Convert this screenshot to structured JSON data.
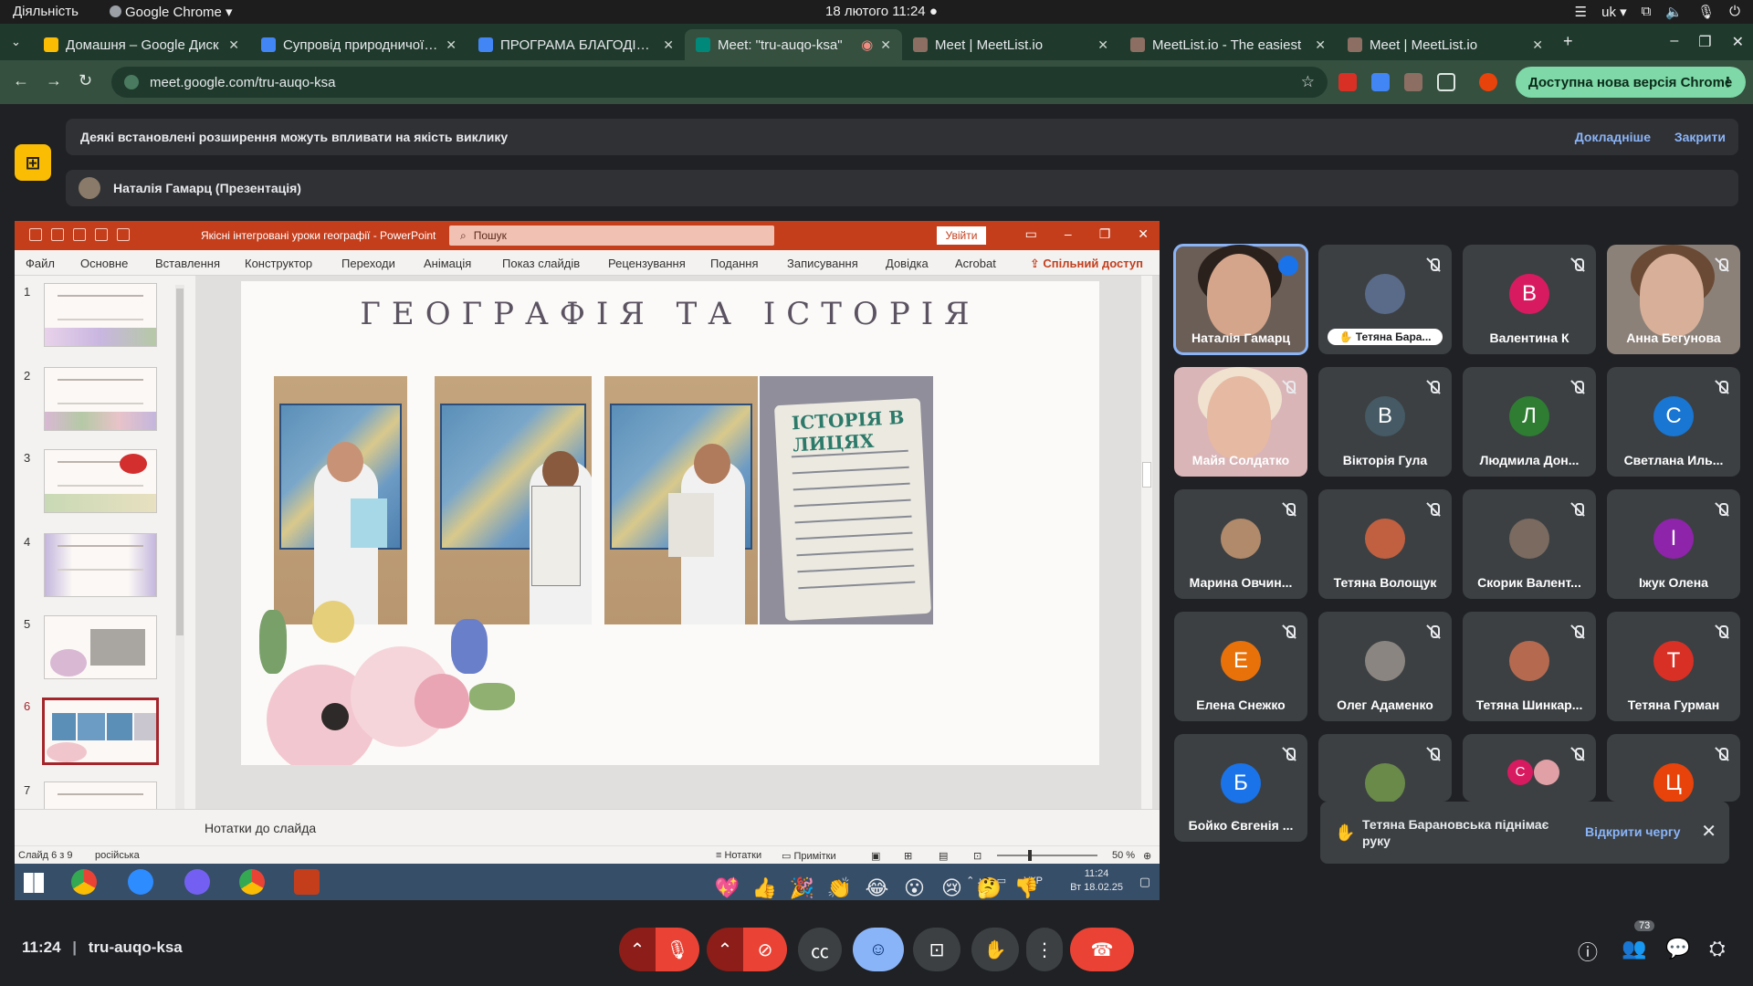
{
  "os": {
    "activities": "Діяльність",
    "app": "Google Chrome ▾",
    "clock": "18 лютого  11:24",
    "lang": "uk ▾"
  },
  "tabs": [
    {
      "title": "Домашня – Google Диск",
      "color": "#fbbc04"
    },
    {
      "title": "Супровід природничої освіти",
      "color": "#4285f4"
    },
    {
      "title": "ПРОГРАМА БЛАГОДІЙНОГО",
      "color": "#4285f4"
    },
    {
      "title": "Meet: \"tru-auqo-ksa\"",
      "color": "#00897b"
    },
    {
      "title": "Meet | MeetList.io",
      "color": "#8d6e63"
    },
    {
      "title": "MeetList.io - The easiest",
      "color": "#8d6e63"
    },
    {
      "title": "Meet | MeetList.io",
      "color": "#8d6e63"
    }
  ],
  "browser": {
    "url": "meet.google.com/tru-auqo-ksa",
    "update_label": "Доступна нова версія Chrome"
  },
  "meet": {
    "ext_warning": "Деякі встановлені розширення можуть впливати на якість виклику",
    "ext_more": "Докладніше",
    "ext_close": "Закрити",
    "presenter": "Наталія Гамарц (Презентація)",
    "code": "tru-auqo-ksa",
    "time": "11:24",
    "people_count": "73"
  },
  "ppt": {
    "doc_title": "Якісні інтегровані уроки географії  -  PowerPoint",
    "search_placeholder": "Пошук",
    "signin": "Увійти",
    "menu": [
      "Файл",
      "Основне",
      "Вставлення",
      "Конструктор",
      "Переходи",
      "Анімація",
      "Показ слайдів",
      "Рецензування",
      "Подання",
      "Записування",
      "Довідка",
      "Acrobat"
    ],
    "share": "Спільний доступ",
    "slide_numbers": [
      "1",
      "2",
      "3",
      "4",
      "5",
      "6",
      "7"
    ],
    "selected_slide": 6,
    "slide_title": "ГЕОГРАФІЯ ТА ІСТОРІЯ",
    "poster_title": "ІСТОРІЯ В ЛИЦЯХ",
    "notes": "Нотатки до слайда",
    "status_slide": "Слайд 6 з 9",
    "status_lang": "російська",
    "status_notes": "Нотатки",
    "status_comments": "Примітки",
    "zoom": "50 %"
  },
  "win_taskbar": {
    "time": "11:24",
    "date": "Вт 18.02.25",
    "lang": "УКР"
  },
  "participants": [
    {
      "name": "Наталія Гамарц",
      "initial": "",
      "color": "",
      "video": true,
      "speaking": true
    },
    {
      "name": "Тетяна Бара...",
      "initial": "",
      "color": "#5a6b8a",
      "hand": true
    },
    {
      "name": "Валентина К",
      "initial": "В",
      "color": "#d81b60"
    },
    {
      "name": "Анна Бегунова",
      "initial": "",
      "color": "",
      "video": true
    },
    {
      "name": "Майя Солдатко",
      "initial": "",
      "color": "",
      "video": true
    },
    {
      "name": "Вікторія Гула",
      "initial": "В",
      "color": "#455a64"
    },
    {
      "name": "Людмила Дон...",
      "initial": "Л",
      "color": "#2e7d32"
    },
    {
      "name": "Светлана Иль...",
      "initial": "С",
      "color": "#1976d2"
    },
    {
      "name": "Марина Овчин...",
      "initial": "",
      "color": "#b08a6a"
    },
    {
      "name": "Тетяна Волощук",
      "initial": "",
      "color": "#c06040"
    },
    {
      "name": "Скорик Валент...",
      "initial": "",
      "color": "#7a6a60"
    },
    {
      "name": "Іжук Олена",
      "initial": "І",
      "color": "#8e24aa"
    },
    {
      "name": "Елена Снежко",
      "initial": "Е",
      "color": "#e8710a"
    },
    {
      "name": "Олег Адаменко",
      "initial": "",
      "color": "#8a8580"
    },
    {
      "name": "Тетяна Шинкар...",
      "initial": "",
      "color": "#b56a50"
    },
    {
      "name": "Тетяна Гурман",
      "initial": "Т",
      "color": "#d93025"
    },
    {
      "name": "Бойко Євгенія ...",
      "initial": "Б",
      "color": "#1a73e8"
    },
    {
      "name": "",
      "initial": "",
      "color": "#6a8a4a"
    },
    {
      "name": "",
      "initial": "С",
      "color": "#d81b60"
    },
    {
      "name": "",
      "initial": "Ц",
      "color": "#e8430a"
    }
  ],
  "toast": {
    "text": "Тетяна Барановська піднімає руку",
    "action": "Відкрити чергу"
  },
  "reactions": [
    "💖",
    "👍",
    "🎉",
    "👏",
    "😂",
    "😮",
    "😢",
    "🤔",
    "👎"
  ]
}
